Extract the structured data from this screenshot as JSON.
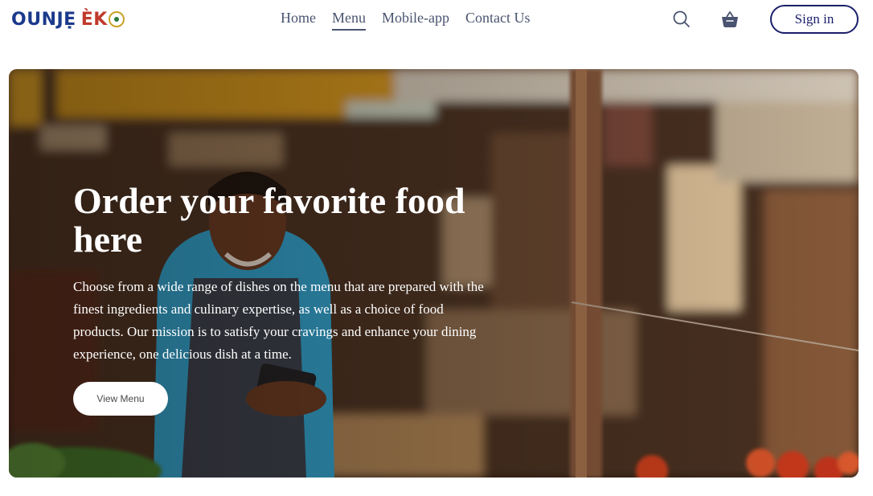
{
  "brand": {
    "logo_text_left": "OUNJẸ",
    "logo_text_right": "ÈK",
    "logo_accent_color": "#c0392b",
    "logo_color": "#1b3a8c"
  },
  "nav": {
    "items": [
      {
        "label": "Home",
        "active": false
      },
      {
        "label": "Menu",
        "active": true
      },
      {
        "label": "Mobile-app",
        "active": false
      },
      {
        "label": "Contact Us",
        "active": false
      }
    ]
  },
  "header": {
    "search_icon": "search-icon",
    "cart_icon": "basket-icon",
    "signin_label": "Sign in",
    "signin_color": "#1a1f6b"
  },
  "hero": {
    "title": "Order your favorite food here",
    "description": "Choose from a wide range of dishes on the menu that are prepared with the finest ingredients and culinary expertise, as well as a choice of food products. Our mission is to satisfy your cravings and enhance your dining experience, one delicious dish at a time.",
    "cta_label": "View Menu"
  }
}
